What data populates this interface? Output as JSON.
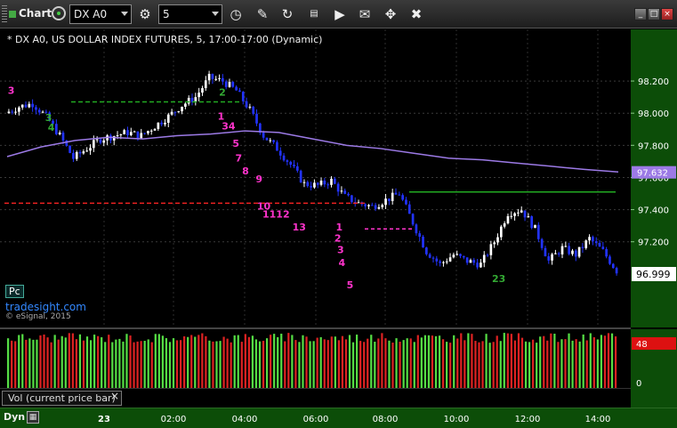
{
  "toolbar": {
    "title": "Chart",
    "symbol": "DX A0",
    "interval": "5",
    "icons": [
      "clock-icon",
      "pencil-icon",
      "refresh-icon",
      "options-icon",
      "play-icon",
      "template-icon",
      "cursor-icon",
      "cross-icon"
    ]
  },
  "chart_header": "* DX A0, US DOLLAR INDEX FUTURES, 5, 17:00-17:00 (Dynamic)",
  "branding": {
    "badge": "Pc",
    "link": "tradesight.com",
    "copyright": "© eSignal, 2015"
  },
  "volume_tab": {
    "label": "Vol (current price bar)",
    "close": "×"
  },
  "time_axis": {
    "label": "Dyn",
    "icon": "lock-icon",
    "ticks": [
      "23",
      "02:00",
      "04:00",
      "06:00",
      "08:00",
      "10:00",
      "12:00",
      "14:00"
    ]
  },
  "colors": {
    "up": "#ffffff",
    "down": "#2233ff",
    "ma": "#9c7ae6",
    "support": "#ee2222",
    "resist": "#22aa22",
    "vol_up": "#55dd44",
    "vol_down": "#dd2222"
  },
  "chart_data": {
    "type": "candlestick",
    "title": "* DX A0, US DOLLAR INDEX FUTURES, 5, 17:00-17:00 (Dynamic)",
    "y_ticks": [
      "98.200",
      "98.000",
      "97.800",
      "97.600",
      "97.400",
      "97.200"
    ],
    "ylim": [
      96.75,
      98.3
    ],
    "last_price": "96.999",
    "ma_value": "97.632",
    "x_ticks": [
      "23",
      "02:00",
      "04:00",
      "06:00",
      "08:00",
      "10:00",
      "12:00",
      "14:00"
    ],
    "path": [
      98.0,
      98.04,
      98.06,
      97.98,
      97.86,
      97.72,
      97.78,
      97.84,
      97.86,
      97.88,
      97.86,
      97.92,
      97.98,
      98.05,
      98.1,
      98.22,
      98.2,
      98.14,
      98.02,
      97.86,
      97.78,
      97.68,
      97.56,
      97.55,
      97.58,
      97.48,
      97.44,
      97.42,
      97.46,
      97.5,
      97.32,
      97.14,
      97.06,
      97.12,
      97.08,
      97.06,
      97.2,
      97.38,
      97.4,
      97.28,
      97.08,
      97.16,
      97.12,
      97.22,
      97.14,
      97.02
    ],
    "ma": [
      97.73,
      97.79,
      97.83,
      97.85,
      97.84,
      97.86,
      97.87,
      97.89,
      97.88,
      97.84,
      97.8,
      97.78,
      97.75,
      97.72,
      97.71,
      97.69,
      97.67,
      97.65,
      97.634
    ],
    "levels": [
      {
        "price": 98.07,
        "color": "resist",
        "dash": true
      },
      {
        "price": 97.44,
        "color": "support",
        "dash": true
      },
      {
        "price": 97.51,
        "color": "resist",
        "dash": false
      }
    ],
    "markers": [
      {
        "label": "3",
        "i": 0.05,
        "p": 98.12,
        "c": "#ff33cc"
      },
      {
        "label": "3",
        "i": 2.8,
        "p": 97.95,
        "c": "#3a3"
      },
      {
        "label": "4",
        "i": 3.0,
        "p": 97.89,
        "c": "#3a3"
      },
      {
        "label": "2",
        "i": 15.6,
        "p": 98.11,
        "c": "#3a3"
      },
      {
        "label": "1",
        "i": 15.5,
        "p": 97.96,
        "c": "#ff33cc"
      },
      {
        "label": "34",
        "i": 15.8,
        "p": 97.9,
        "c": "#ff33cc"
      },
      {
        "label": "5",
        "i": 16.6,
        "p": 97.79,
        "c": "#ff33cc"
      },
      {
        "label": "7",
        "i": 16.8,
        "p": 97.7,
        "c": "#ff33cc"
      },
      {
        "label": "8",
        "i": 17.3,
        "p": 97.62,
        "c": "#ff33cc"
      },
      {
        "label": "9",
        "i": 18.3,
        "p": 97.57,
        "c": "#ff33cc"
      },
      {
        "label": "10",
        "i": 18.4,
        "p": 97.4,
        "c": "#ff33cc"
      },
      {
        "label": "1112",
        "i": 18.8,
        "p": 97.35,
        "c": "#ff33cc"
      },
      {
        "label": "13",
        "i": 21.0,
        "p": 97.27,
        "c": "#ff33cc"
      },
      {
        "label": "1",
        "i": 24.2,
        "p": 97.27,
        "c": "#ff33cc"
      },
      {
        "label": "2",
        "i": 24.1,
        "p": 97.2,
        "c": "#ff33cc"
      },
      {
        "label": "3",
        "i": 24.3,
        "p": 97.13,
        "c": "#ff33cc"
      },
      {
        "label": "4",
        "i": 24.4,
        "p": 97.05,
        "c": "#ff33cc"
      },
      {
        "label": "5",
        "i": 25.0,
        "p": 96.91,
        "c": "#ff33cc"
      },
      {
        "label": "23",
        "i": 35.7,
        "p": 96.95,
        "c": "#3a3"
      }
    ],
    "volume": {
      "max_label": "48",
      "zero_label": "0"
    }
  }
}
